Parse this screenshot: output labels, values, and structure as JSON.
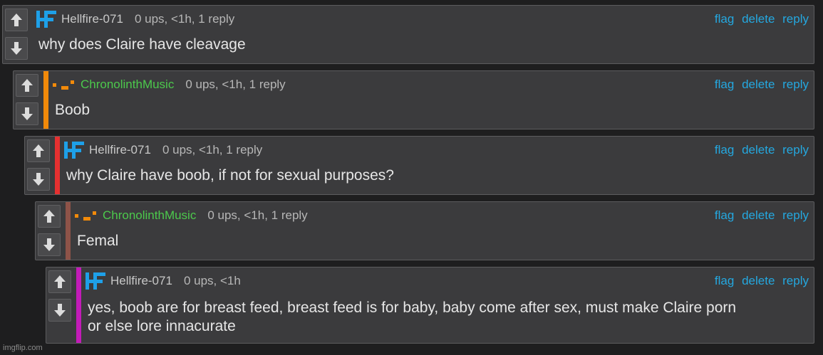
{
  "comments": [
    {
      "user": "Hellfire-071",
      "meta": "0 ups, <1h, 1 reply",
      "text": "why does Claire have cleavage",
      "flag": "flag",
      "delete": "delete",
      "reply": "reply",
      "avatar": "hf-logo-icon",
      "depth_color": ""
    },
    {
      "user": "ChronolinthMusic",
      "meta": "0 ups, <1h, 1 reply",
      "text": "Boob",
      "flag": "flag",
      "delete": "delete",
      "reply": "reply",
      "avatar": "chronolinth-logo-icon",
      "depth_color": "#f28a0a"
    },
    {
      "user": "Hellfire-071",
      "meta": "0 ups, <1h, 1 reply",
      "text": "why Claire have boob, if not for sexual purposes?",
      "flag": "flag",
      "delete": "delete",
      "reply": "reply",
      "avatar": "hf-logo-icon",
      "depth_color": "#e53030"
    },
    {
      "user": "ChronolinthMusic",
      "meta": "0 ups, <1h, 1 reply",
      "text": "Femal",
      "flag": "flag",
      "delete": "delete",
      "reply": "reply",
      "avatar": "chronolinth-logo-icon",
      "depth_color": "#8e5348"
    },
    {
      "user": "Hellfire-071",
      "meta": "0 ups, <1h",
      "text_line1": "yes, boob are for breast feed, breast feed is for baby, baby come after sex, must make Claire porn",
      "text_line2": "or else lore innacurate",
      "flag": "flag",
      "delete": "delete",
      "reply": "reply",
      "avatar": "hf-logo-icon",
      "depth_color": "#c31bb8"
    }
  ],
  "colors": {
    "background": "#1e1e1f",
    "panel": "#3b3b3d",
    "link": "#24a8e0",
    "username_green": "#4cc94c"
  },
  "watermark": "imgflip.com"
}
